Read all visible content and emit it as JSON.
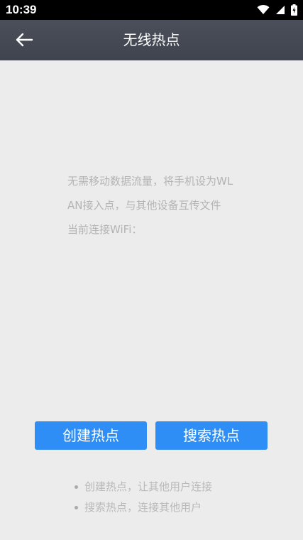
{
  "status_bar": {
    "time": "10:39",
    "icons": [
      "wifi-icon",
      "cell-signal-icon",
      "battery-icon"
    ]
  },
  "app_bar": {
    "title": "无线热点",
    "back_icon": "arrow-left-icon"
  },
  "description": {
    "text": "无需移动数据流量，将手机设为WLAN接入点，与其他设备互传文件",
    "current_wifi_label": "当前连接WiFi："
  },
  "buttons": {
    "create": "创建热点",
    "search": "搜索热点"
  },
  "tips": [
    {
      "text": "创建热点，让其他用户连接"
    },
    {
      "text": "搜索热点，连接其他用户"
    }
  ],
  "colors": {
    "app_bar": "#434852",
    "background": "#ececec",
    "primary_button": "#2f8ef5",
    "muted_text": "#b4b4b4"
  }
}
